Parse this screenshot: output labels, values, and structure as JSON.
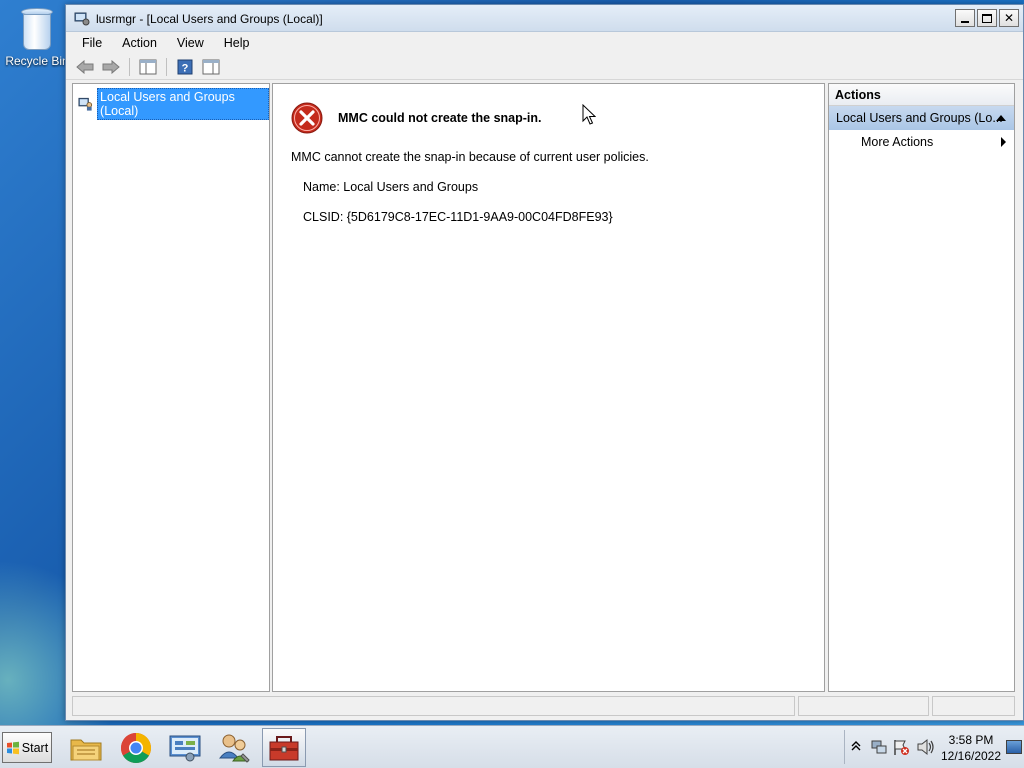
{
  "desktop": {
    "recycle_bin_label": "Recycle Bin"
  },
  "window": {
    "title": "lusrmgr - [Local Users and Groups (Local)]",
    "controls": {
      "minimize": "_",
      "maximize": "□",
      "close": "✕"
    }
  },
  "menubar": {
    "items": [
      "File",
      "Action",
      "View",
      "Help"
    ]
  },
  "toolbar": {
    "buttons": [
      "back-arrow-icon",
      "forward-arrow-icon",
      "show-hide-console-tree-icon",
      "help-icon",
      "show-hide-action-pane-icon"
    ]
  },
  "tree": {
    "root_label": "Local Users and Groups (Local)"
  },
  "main": {
    "error_title": "MMC could not create the snap-in.",
    "error_description": "MMC cannot create the snap-in because of current user policies.",
    "name_line": "Name: Local Users and Groups",
    "clsid_line": "CLSID: {5D6179C8-17EC-11D1-9AA9-00C04FD8FE93}"
  },
  "actions": {
    "header": "Actions",
    "group_label": "Local Users and Groups (Lo...",
    "items": [
      "More Actions"
    ]
  },
  "taskbar": {
    "start_label": "Start",
    "apps": [
      "file-explorer-icon",
      "chrome-icon",
      "control-panel-icon",
      "users-icon",
      "toolbox-icon"
    ],
    "clock_time": "3:58 PM",
    "clock_date": "12/16/2022"
  },
  "colors": {
    "selection": "#3399ff",
    "error_red": "#c42b1c",
    "actions_group_bg": "#b8cfea"
  }
}
